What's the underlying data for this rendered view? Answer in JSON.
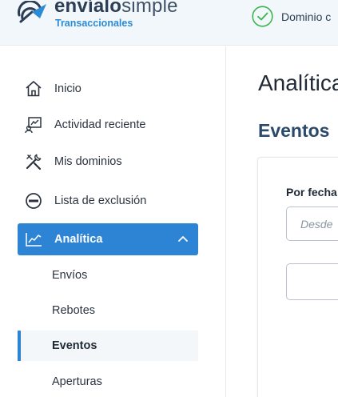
{
  "header": {
    "brand_bold": "envíalo",
    "brand_light": "simple",
    "brand_sub": "Transaccionales",
    "status_text": "Dominio c"
  },
  "sidebar": {
    "items": [
      {
        "label": "Inicio",
        "icon": "home-icon"
      },
      {
        "label": "Actividad reciente",
        "icon": "activity-icon"
      },
      {
        "label": "Mis dominios",
        "icon": "tools-icon"
      },
      {
        "label": "Lista de exclusión",
        "icon": "block-icon"
      },
      {
        "label": "Analítica",
        "icon": "chart-icon",
        "active": true
      }
    ],
    "subitems": [
      {
        "label": "Envíos"
      },
      {
        "label": "Rebotes"
      },
      {
        "label": "Eventos",
        "current": true
      },
      {
        "label": "Aperturas"
      }
    ]
  },
  "main": {
    "page_title": "Analítica",
    "section_title": "Eventos",
    "filter_label": "Por fecha",
    "date_placeholder": "Desde"
  },
  "colors": {
    "accent": "#2e84d4",
    "header_bg": "#f2f7fc",
    "success": "#3bb54a"
  }
}
